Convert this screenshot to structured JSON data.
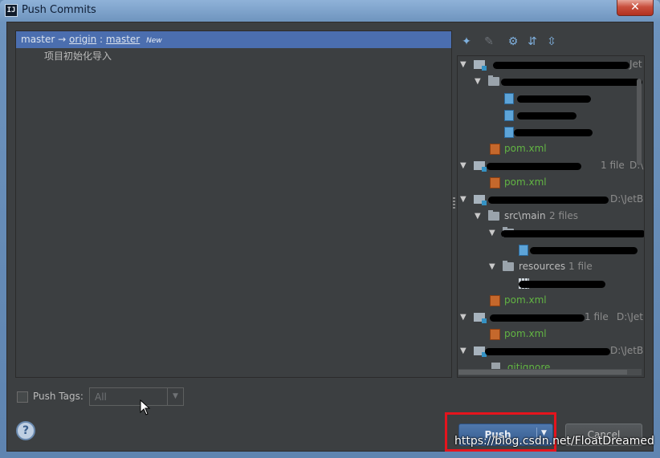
{
  "window": {
    "title": "Push Commits",
    "app_icon": "intellij-icon",
    "close_glyph": "✕"
  },
  "commits": {
    "branch": {
      "local": "master",
      "arrow": "→",
      "remote": "origin",
      "sep": ":",
      "remote_branch": "master",
      "badge": "New"
    },
    "messages": [
      "项目初始化导入"
    ]
  },
  "toolbar": {
    "icons": [
      "pin-icon",
      "edit-icon",
      "settings-icon",
      "expand-all-icon",
      "collapse-all-icon"
    ]
  },
  "tree": {
    "rows": [
      {
        "suffix": "Jet",
        "tail": ""
      },
      {
        "suffix": "pom.xml"
      },
      {
        "suffix": "1 file",
        "tail": "D:\\"
      },
      {
        "suffix": "pom.xml"
      },
      {
        "tail": "D:\\JetBr"
      },
      {
        "label": "src\\main",
        "count": "2 files"
      },
      {
        "label": "resources",
        "count": "1 file"
      },
      {
        "suffix": "pom.xml"
      },
      {
        "count": "1 file",
        "tail": "D:\\JetB"
      },
      {
        "suffix": "pom.xml"
      },
      {
        "tail": "D:\\JetBr"
      },
      {
        "suffix": ".gitignore"
      }
    ]
  },
  "footer": {
    "push_tags_label": "Push Tags:",
    "tags_value": "All",
    "help": "?",
    "push": "Push",
    "cancel": "Cancel"
  },
  "watermark": "https://blog.csdn.net/FloatDreamed",
  "colors": {
    "accent": "#4b6eaf",
    "highlight": "#e5141d",
    "file_green": "#62b543"
  }
}
